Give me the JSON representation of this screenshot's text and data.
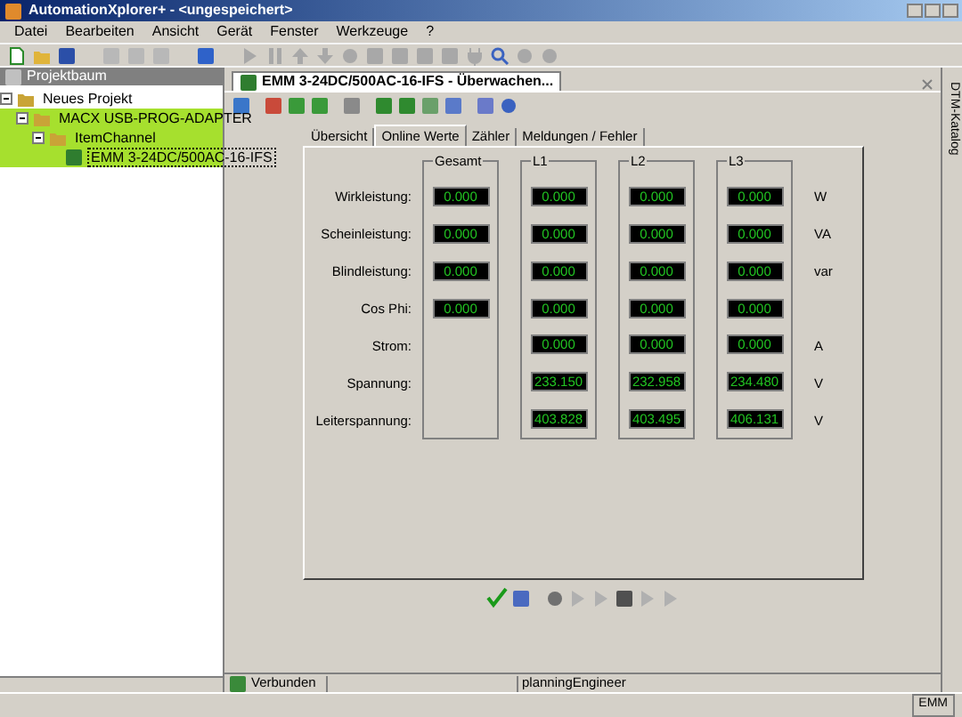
{
  "window": {
    "title": "AutomationXplorer+ - <ungespeichert>"
  },
  "menu": [
    "Datei",
    "Bearbeiten",
    "Ansicht",
    "Gerät",
    "Fenster",
    "Werkzeuge",
    "?"
  ],
  "sidebar": {
    "title": "Projektbaum",
    "tree": [
      {
        "label": "Neues Projekt",
        "expanded": true,
        "selected": false,
        "connected": false,
        "children": [
          {
            "label": "MACX USB-PROG-ADAPTER",
            "expanded": true,
            "selected": false,
            "connected": true,
            "children": [
              {
                "label": "ItemChannel",
                "expanded": true,
                "selected": false,
                "connected": true,
                "children": [
                  {
                    "label": "EMM 3-24DC/500AC-16-IFS",
                    "selected": true,
                    "connected": true
                  }
                ]
              }
            ]
          }
        ]
      }
    ]
  },
  "document": {
    "title": "EMM 3-24DC/500AC-16-IFS - Überwachen...",
    "tabs": [
      {
        "label": "Übersicht",
        "selected": false
      },
      {
        "label": "Online Werte",
        "selected": true
      },
      {
        "label": "Zähler",
        "selected": false
      },
      {
        "label": "Meldungen / Fehler",
        "selected": false
      }
    ],
    "groups": [
      "Gesamt",
      "L1",
      "L2",
      "L3"
    ],
    "rows": [
      {
        "label": "Wirkleistung:",
        "total": "0.000",
        "phases": [
          "0.000",
          "0.000",
          "0.000"
        ],
        "unit": "W"
      },
      {
        "label": "Scheinleistung:",
        "total": "0.000",
        "phases": [
          "0.000",
          "0.000",
          "0.000"
        ],
        "unit": "VA"
      },
      {
        "label": "Blindleistung:",
        "total": "0.000",
        "phases": [
          "0.000",
          "0.000",
          "0.000"
        ],
        "unit": "var"
      },
      {
        "label": "Cos Phi:",
        "total": "0.000",
        "phases": [
          "0.000",
          "0.000",
          "0.000"
        ]
      },
      {
        "label": "Strom:",
        "phases": [
          "0.000",
          "0.000",
          "0.000"
        ],
        "unit": "A"
      },
      {
        "label": "Spannung:",
        "phases": [
          "233.150",
          "232.958",
          "234.480"
        ],
        "unit": "V"
      },
      {
        "label": "Leiterspannung:",
        "phases": [
          "403.828",
          "403.495",
          "406.131"
        ],
        "unit": "V"
      }
    ]
  },
  "status_bar": {
    "connection": "Verbunden",
    "user": "planningEngineer"
  },
  "bottom_bar": {
    "device": "EMM"
  },
  "right_panel": {
    "title": "DTM-Katalog"
  }
}
